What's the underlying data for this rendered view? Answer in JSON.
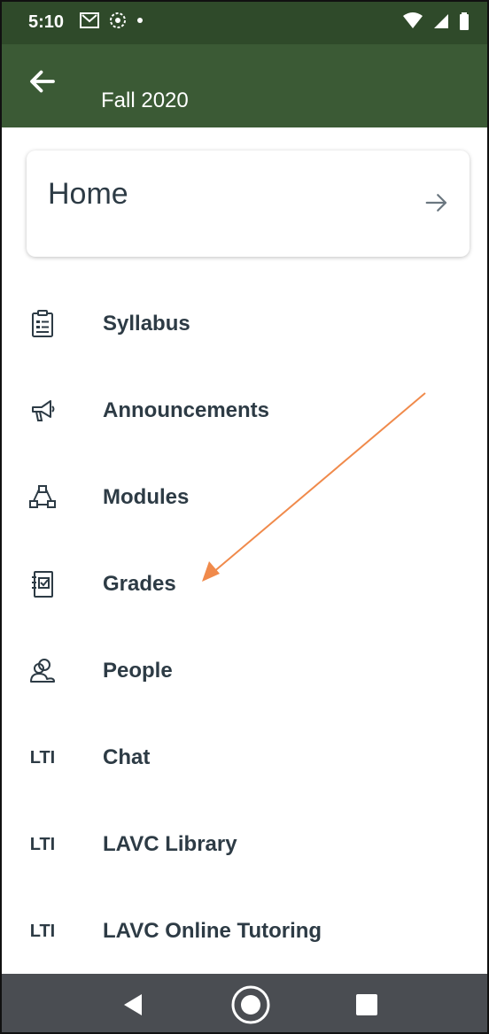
{
  "status_bar": {
    "time": "5:10"
  },
  "header": {
    "subtitle": "Fall 2020"
  },
  "home_card": {
    "label": "Home"
  },
  "nav_items": [
    {
      "label": "Syllabus",
      "icon": "syllabus-icon"
    },
    {
      "label": "Announcements",
      "icon": "megaphone-icon"
    },
    {
      "label": "Modules",
      "icon": "modules-icon"
    },
    {
      "label": "Grades",
      "icon": "gradebook-icon"
    },
    {
      "label": "People",
      "icon": "people-icon"
    },
    {
      "label": "Chat",
      "icon": "lti-icon",
      "icon_text": "LTI"
    },
    {
      "label": "LAVC Library",
      "icon": "lti-icon",
      "icon_text": "LTI"
    },
    {
      "label": "LAVC Online Tutoring",
      "icon": "lti-icon",
      "icon_text": "LTI"
    }
  ],
  "colors": {
    "status_bar": "#2f4a2a",
    "header": "#3b5a35",
    "text": "#2d3b45",
    "annotation_arrow": "#f08a4b",
    "system_nav": "#4a4d52"
  }
}
